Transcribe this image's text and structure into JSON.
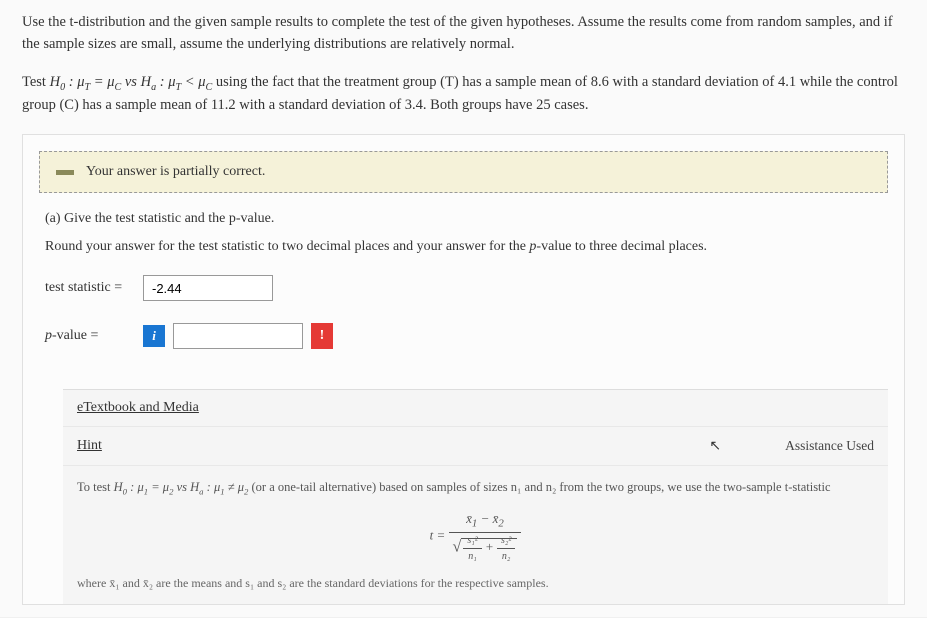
{
  "intro": "Use the t-distribution and the given sample results to complete the test of the given hypotheses. Assume the results come from random samples, and if the sample sizes are small, assume the underlying distributions are relatively normal.",
  "test_prefix": "Test ",
  "test_mid": " using the fact that the treatment group (T) has a sample mean of 8.6 with a standard deviation of 4.1 while the control group (C) has a sample mean of 11.2 with a standard deviation of 3.4. Both groups have 25 cases.",
  "feedback": "Your answer is partially correct.",
  "part_a": "(a) Give the test statistic and the p-value.",
  "round_instr": "Round your answer for the test statistic to two decimal places and your answer for the p-value to three decimal places.",
  "labels": {
    "test_stat": "test statistic =",
    "pvalue": "p-value ="
  },
  "inputs": {
    "test_stat_value": "-2.44",
    "pvalue_value": ""
  },
  "info_icon": "i",
  "error_icon": "!",
  "resources": {
    "etextbook": "eTextbook and Media",
    "hint": "Hint",
    "assistance": "Assistance Used"
  },
  "hint_text_prefix": "To test ",
  "hint_text_suffix": " (or a one-tail alternative) based on samples of sizes n₁ and n₂ from the two groups, we use the two-sample t-statistic",
  "where_text": "where x̄₁ and x̄₂ are the means and s₁ and s₂ are the standard deviations for the respective samples."
}
